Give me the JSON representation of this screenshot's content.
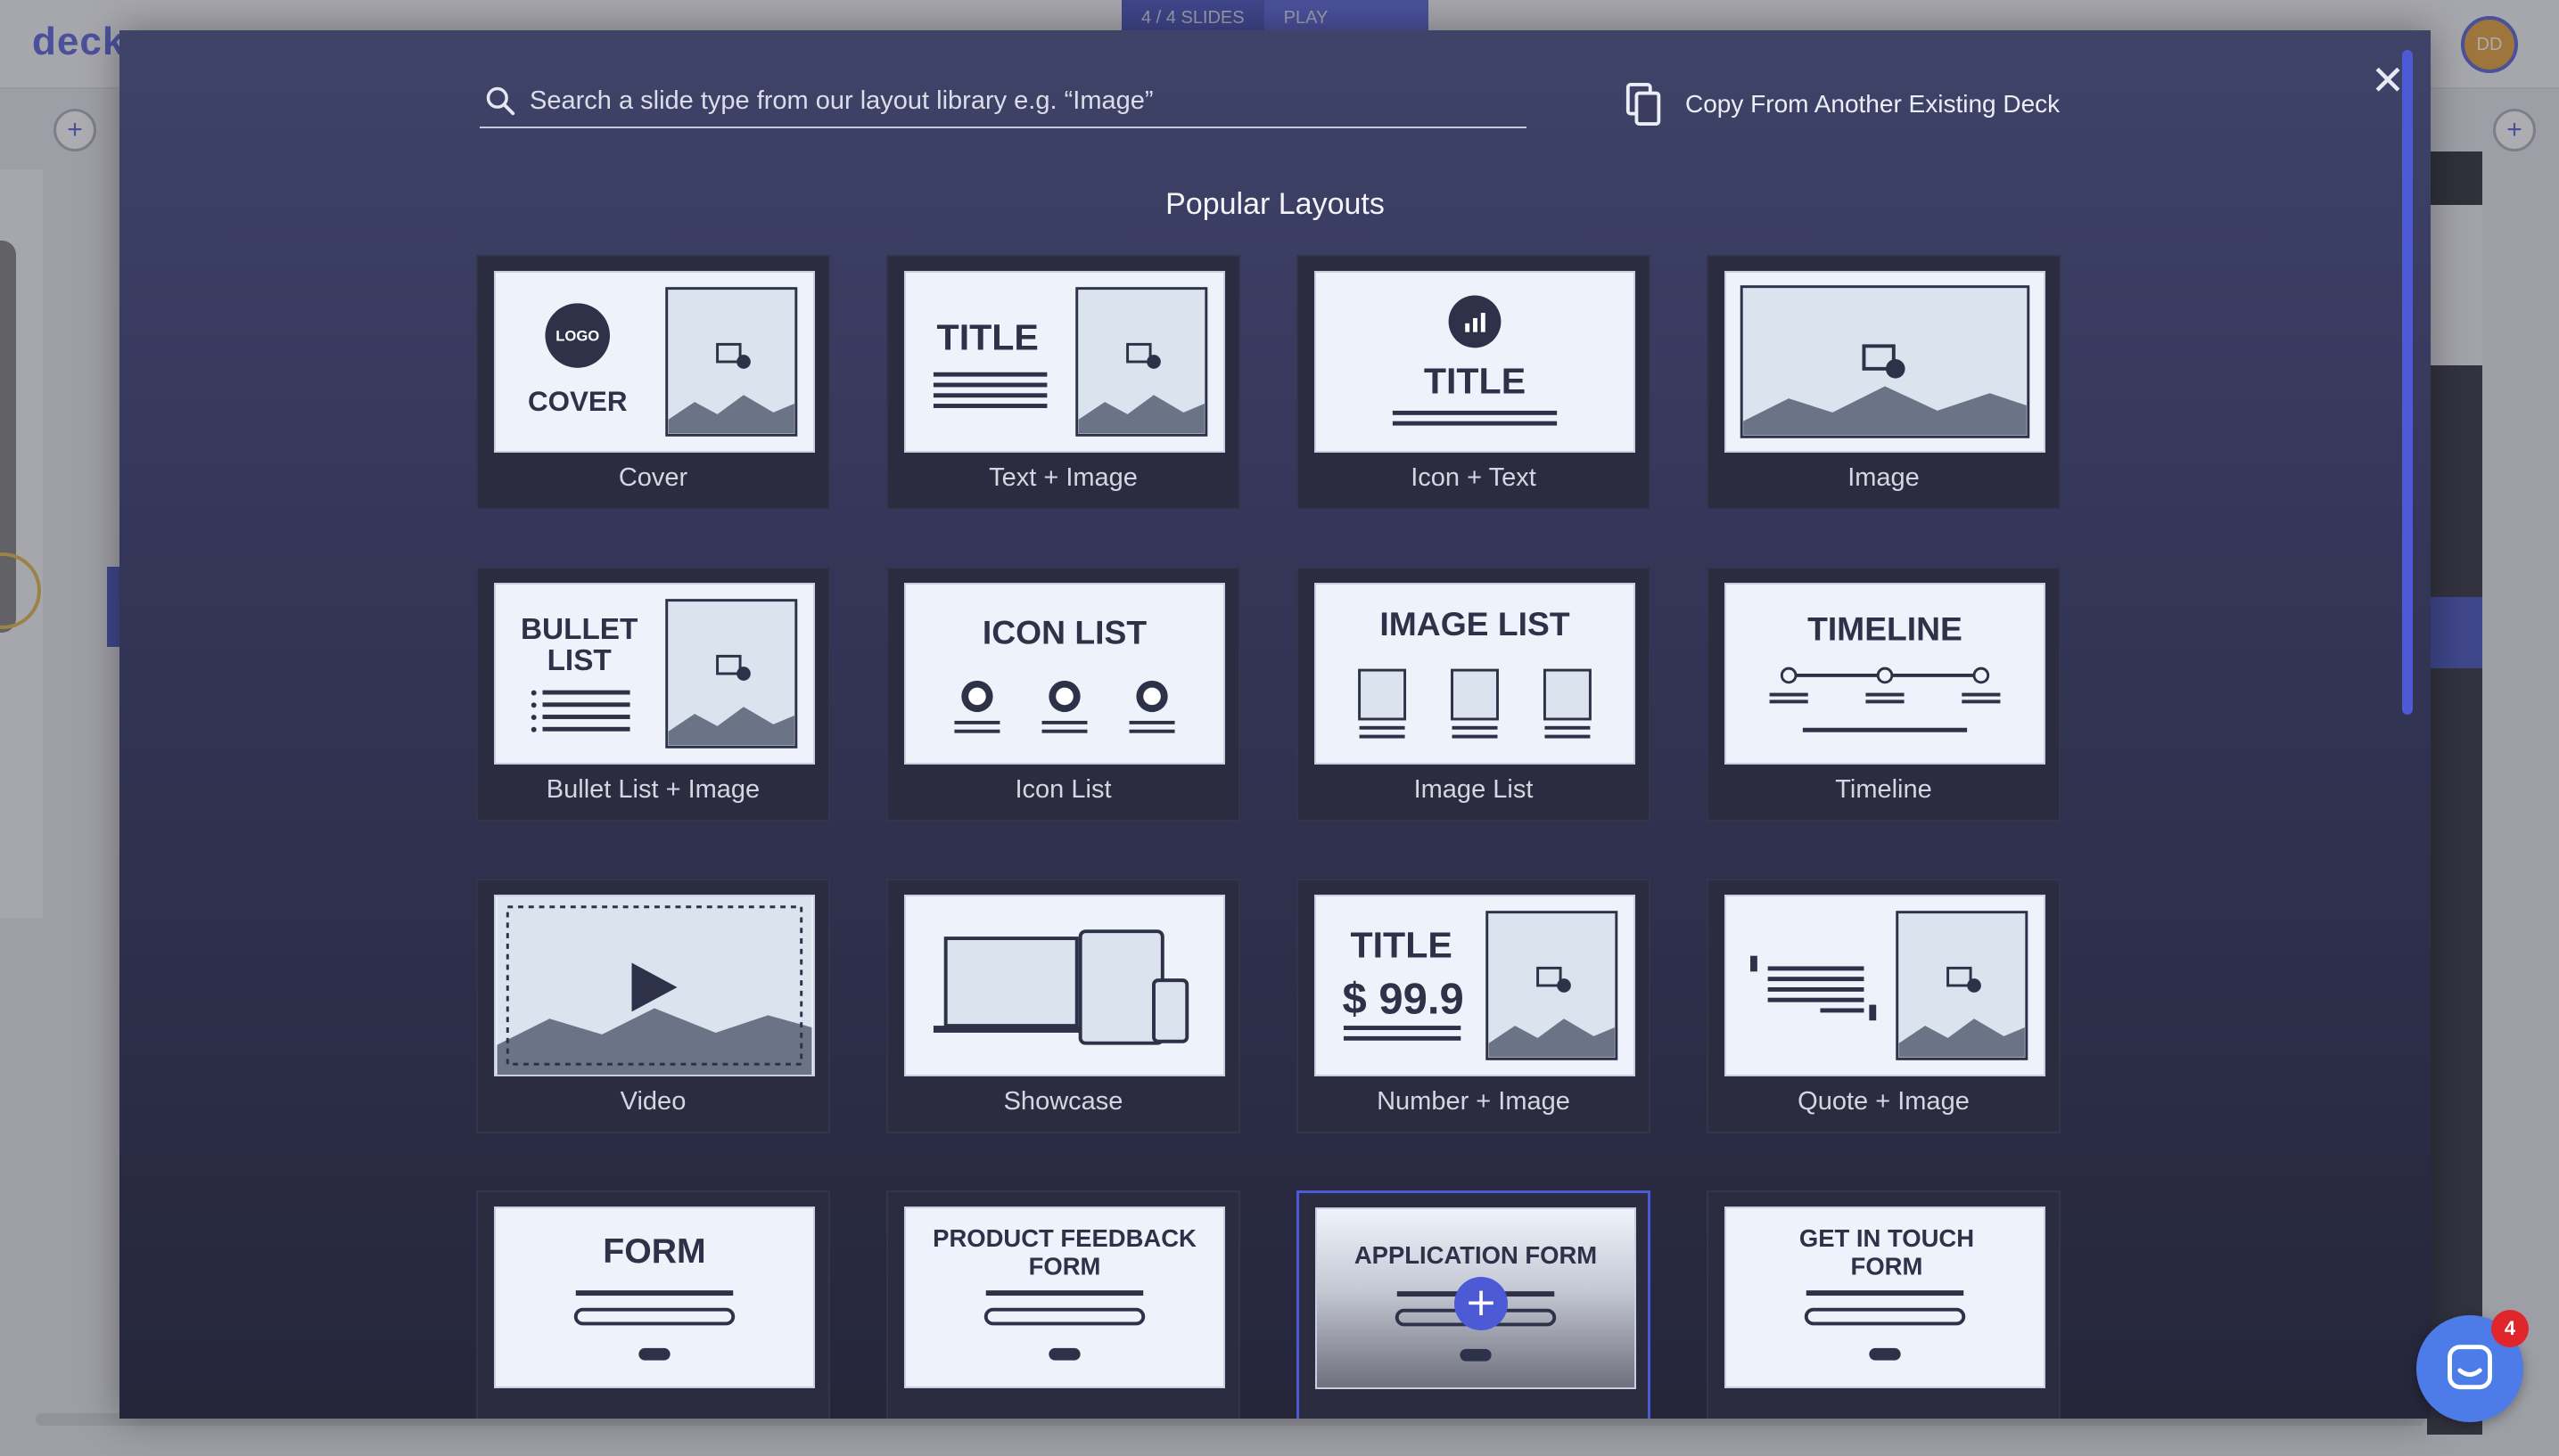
{
  "background": {
    "logo_text": "deck",
    "slides_chip": "4 / 4 SLIDES",
    "play_label": "PLAY",
    "avatar_initials": "DD"
  },
  "modal": {
    "search": {
      "placeholder": "Search a slide type from our layout library e.g. “Image”",
      "value": ""
    },
    "copy_button_label": "Copy From Another Existing Deck",
    "close_icon": "close-icon",
    "section_title": "Popular Layouts",
    "layouts": [
      {
        "label": "Cover",
        "thumb_text": [
          "LOGO",
          "COVER"
        ]
      },
      {
        "label": "Text + Image",
        "thumb_text": [
          "TITLE"
        ]
      },
      {
        "label": "Icon + Text",
        "thumb_text": [
          "TITLE"
        ]
      },
      {
        "label": "Image",
        "thumb_text": []
      },
      {
        "label": "Bullet List + Image",
        "thumb_text": [
          "BULLET",
          "LIST"
        ]
      },
      {
        "label": "Icon List",
        "thumb_text": [
          "ICON LIST"
        ]
      },
      {
        "label": "Image List",
        "thumb_text": [
          "IMAGE LIST"
        ]
      },
      {
        "label": "Timeline",
        "thumb_text": [
          "TIMELINE"
        ]
      },
      {
        "label": "Video",
        "thumb_text": []
      },
      {
        "label": "Showcase",
        "thumb_text": []
      },
      {
        "label": "Number + Image",
        "thumb_text": [
          "TITLE",
          "$ 99.9"
        ]
      },
      {
        "label": "Quote + Image",
        "thumb_text": []
      },
      {
        "label": "",
        "thumb_text": [
          "FORM"
        ]
      },
      {
        "label": "",
        "thumb_text": [
          "PRODUCT FEEDBACK",
          "FORM"
        ]
      },
      {
        "label": "",
        "thumb_text": [
          "APPLICATION FORM"
        ],
        "selected": true
      },
      {
        "label": "",
        "thumb_text": [
          "GET IN TOUCH",
          "FORM"
        ]
      }
    ]
  },
  "chat": {
    "unread_count": "4"
  },
  "colors": {
    "accent": "#4d5ad6",
    "modal_top": "#3f4368",
    "modal_bottom": "#25263a",
    "thumb_ink": "#2e3248",
    "chat_blue": "#4d7ce8",
    "badge_red": "#e0262b"
  }
}
